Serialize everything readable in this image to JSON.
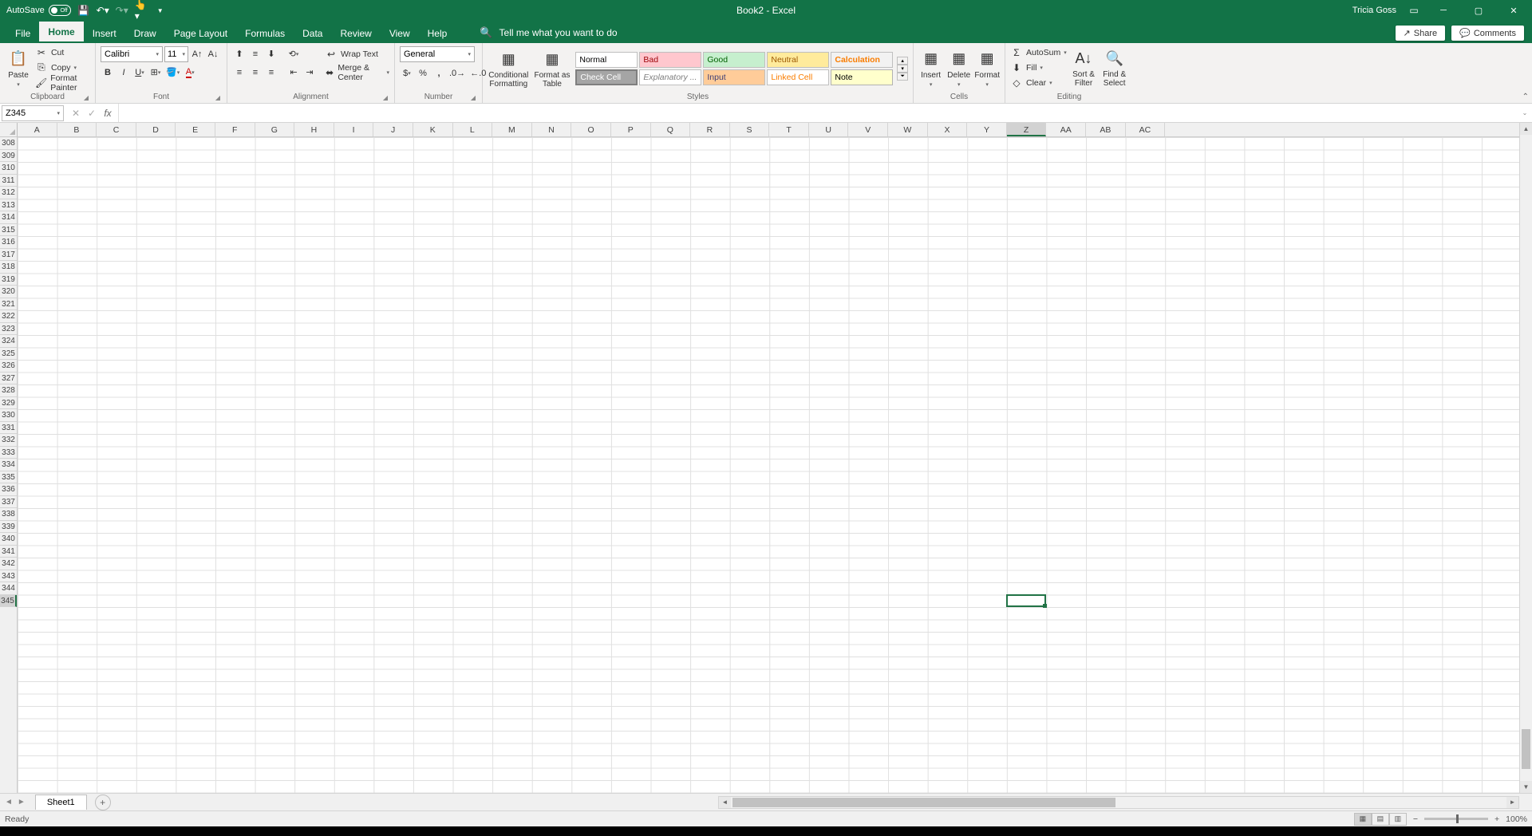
{
  "titlebar": {
    "autosave_label": "AutoSave",
    "autosave_state": "Off",
    "doc_title": "Book2 - Excel",
    "user_name": "Tricia Goss"
  },
  "tabs": {
    "file": "File",
    "home": "Home",
    "insert": "Insert",
    "draw": "Draw",
    "page_layout": "Page Layout",
    "formulas": "Formulas",
    "data": "Data",
    "review": "Review",
    "view": "View",
    "help": "Help",
    "tellme": "Tell me what you want to do",
    "share": "Share",
    "comments": "Comments"
  },
  "ribbon": {
    "clipboard": {
      "paste": "Paste",
      "cut": "Cut",
      "copy": "Copy",
      "format_painter": "Format Painter",
      "label": "Clipboard"
    },
    "font": {
      "name": "Calibri",
      "size": "11",
      "label": "Font"
    },
    "alignment": {
      "wrap": "Wrap Text",
      "merge": "Merge & Center",
      "label": "Alignment"
    },
    "number": {
      "format": "General",
      "label": "Number"
    },
    "styles": {
      "cond_fmt": "Conditional Formatting",
      "fmt_table": "Format as Table",
      "normal": "Normal",
      "bad": "Bad",
      "good": "Good",
      "neutral": "Neutral",
      "calculation": "Calculation",
      "check": "Check Cell",
      "explan": "Explanatory ...",
      "input": "Input",
      "linked": "Linked Cell",
      "note": "Note",
      "label": "Styles"
    },
    "cells": {
      "insert": "Insert",
      "delete": "Delete",
      "format": "Format",
      "label": "Cells"
    },
    "editing": {
      "autosum": "AutoSum",
      "fill": "Fill",
      "clear": "Clear",
      "sort": "Sort & Filter",
      "find": "Find & Select",
      "label": "Editing"
    }
  },
  "formula_bar": {
    "name_box": "Z345"
  },
  "grid": {
    "columns": [
      "A",
      "B",
      "C",
      "D",
      "E",
      "F",
      "G",
      "H",
      "I",
      "J",
      "K",
      "L",
      "M",
      "N",
      "O",
      "P",
      "Q",
      "R",
      "S",
      "T",
      "U",
      "V",
      "W",
      "X",
      "Y",
      "Z",
      "AA",
      "AB",
      "AC"
    ],
    "row_start": 308,
    "row_end": 345,
    "active_col": "Z",
    "active_row": 345
  },
  "sheets": {
    "sheet1": "Sheet1"
  },
  "status": {
    "ready": "Ready",
    "zoom": "100%"
  }
}
